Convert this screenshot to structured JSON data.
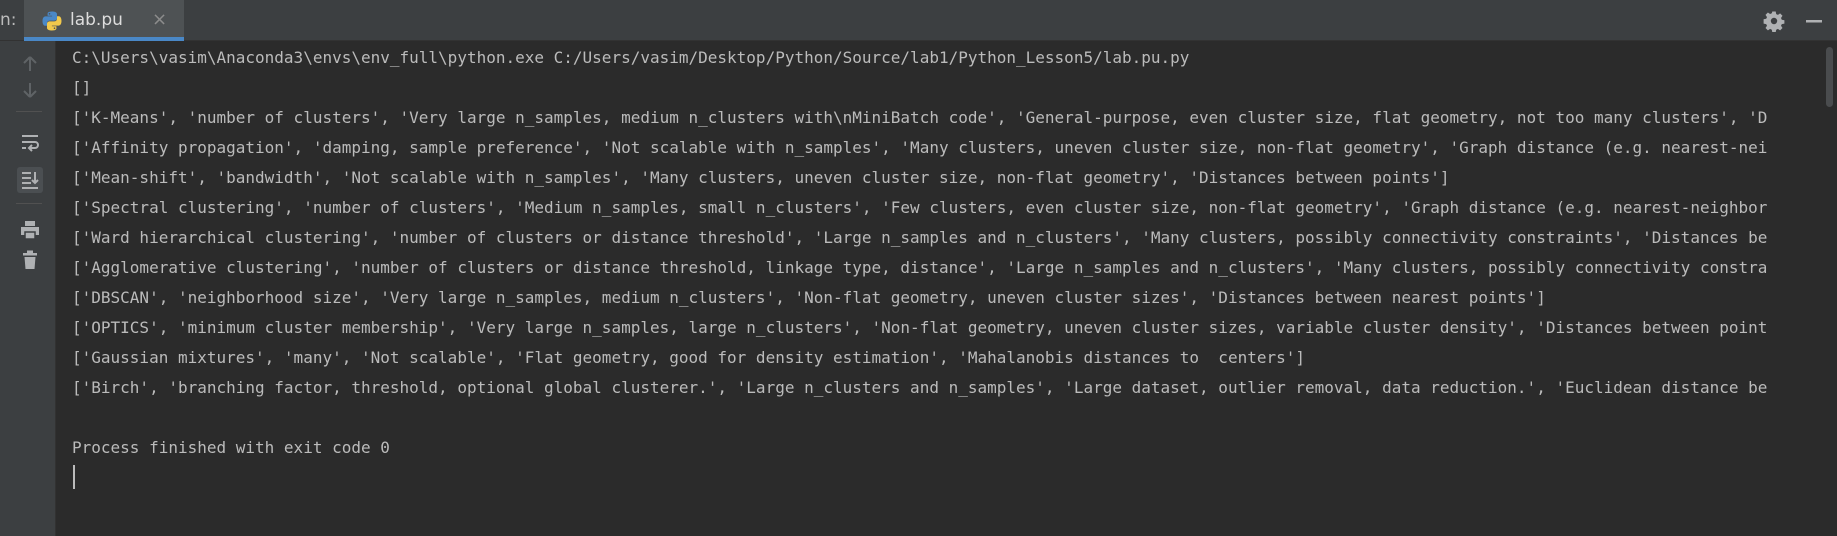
{
  "tool_window": {
    "label": "n:"
  },
  "tab": {
    "title": "lab.pu",
    "close": "×",
    "icon": "python-file-icon"
  },
  "toolbar_right": {
    "settings_icon": "gear-icon",
    "hide_icon": "minimize-icon"
  },
  "sidebar": {
    "icons": [
      "arrow-up-icon",
      "arrow-down-icon",
      "soft-wrap-icon",
      "scroll-to-end-icon",
      "print-icon",
      "trash-icon"
    ]
  },
  "colors": {
    "background": "#2b2b2b",
    "panel": "#3c3f41",
    "text": "#bbbbbb",
    "accent": "#4a88c7"
  },
  "console": {
    "lines": [
      "C:\\Users\\vasim\\Anaconda3\\envs\\env_full\\python.exe C:/Users/vasim/Desktop/Python/Source/lab1/Python_Lesson5/lab.pu.py",
      "[]",
      "['K-Means', 'number of clusters', 'Very large n_samples, medium n_clusters with\\nMiniBatch code', 'General-purpose, even cluster size, flat geometry, not too many clusters', 'D",
      "['Affinity propagation', 'damping, sample preference', 'Not scalable with n_samples', 'Many clusters, uneven cluster size, non-flat geometry', 'Graph distance (e.g. nearest-nei",
      "['Mean-shift', 'bandwidth', 'Not scalable with n_samples', 'Many clusters, uneven cluster size, non-flat geometry', 'Distances between points']",
      "['Spectral clustering', 'number of clusters', 'Medium n_samples, small n_clusters', 'Few clusters, even cluster size, non-flat geometry', 'Graph distance (e.g. nearest-neighbor",
      "['Ward hierarchical clustering', 'number of clusters or distance threshold', 'Large n_samples and n_clusters', 'Many clusters, possibly connectivity constraints', 'Distances be",
      "['Agglomerative clustering', 'number of clusters or distance threshold, linkage type, distance', 'Large n_samples and n_clusters', 'Many clusters, possibly connectivity constra",
      "['DBSCAN', 'neighborhood size', 'Very large n_samples, medium n_clusters', 'Non-flat geometry, uneven cluster sizes', 'Distances between nearest points']",
      "['OPTICS', 'minimum cluster membership', 'Very large n_samples, large n_clusters', 'Non-flat geometry, uneven cluster sizes, variable cluster density', 'Distances between point",
      "['Gaussian mixtures', 'many', 'Not scalable', 'Flat geometry, good for density estimation', 'Mahalanobis distances to  centers']",
      "['Birch', 'branching factor, threshold, optional global clusterer.', 'Large n_clusters and n_samples', 'Large dataset, outlier removal, data reduction.', 'Euclidean distance be",
      "",
      "Process finished with exit code 0"
    ]
  }
}
